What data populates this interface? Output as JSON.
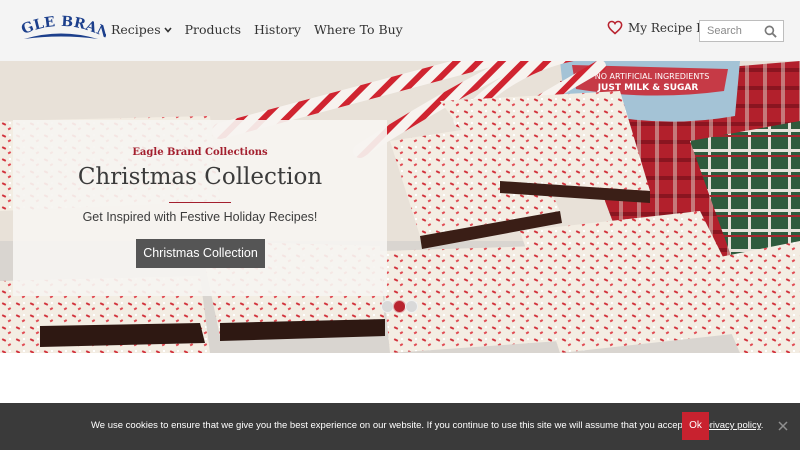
{
  "brand": {
    "logo_text": "EAGLE BRAND"
  },
  "nav": {
    "items": [
      {
        "label": "Recipes",
        "has_dropdown": true
      },
      {
        "label": "Products"
      },
      {
        "label": "History"
      },
      {
        "label": "Where To Buy"
      }
    ]
  },
  "recipe_box": {
    "label": "My Recipe Box",
    "icon": "heart-icon"
  },
  "search": {
    "placeholder": "Search",
    "icon": "search-icon"
  },
  "hero": {
    "jar_label_line1": "NO ARTIFICIAL INGREDIENTS",
    "jar_label_line2": "JUST MILK & SUGAR",
    "eyebrow": "Eagle Brand Collections",
    "title": "Christmas Collection",
    "subtitle": "Get Inspired with Festive Holiday Recipes!",
    "button_label": "Christmas Collection",
    "carousel": {
      "slides": 3,
      "active_index": 1
    }
  },
  "cookie": {
    "text": "We use cookies to ensure that we give you the best experience on our website. If you continue to use this site we will assume that you accept our",
    "link_label": "privacy policy",
    "trailing": ".",
    "ok_label": "Ok",
    "close_icon": "close-icon"
  },
  "colors": {
    "brand_red": "#c8222f",
    "logo_blue": "#1c3f8c",
    "header_bg": "#f4f4f4",
    "cookie_bg": "#3a3a3a",
    "button_gray": "#555555"
  }
}
